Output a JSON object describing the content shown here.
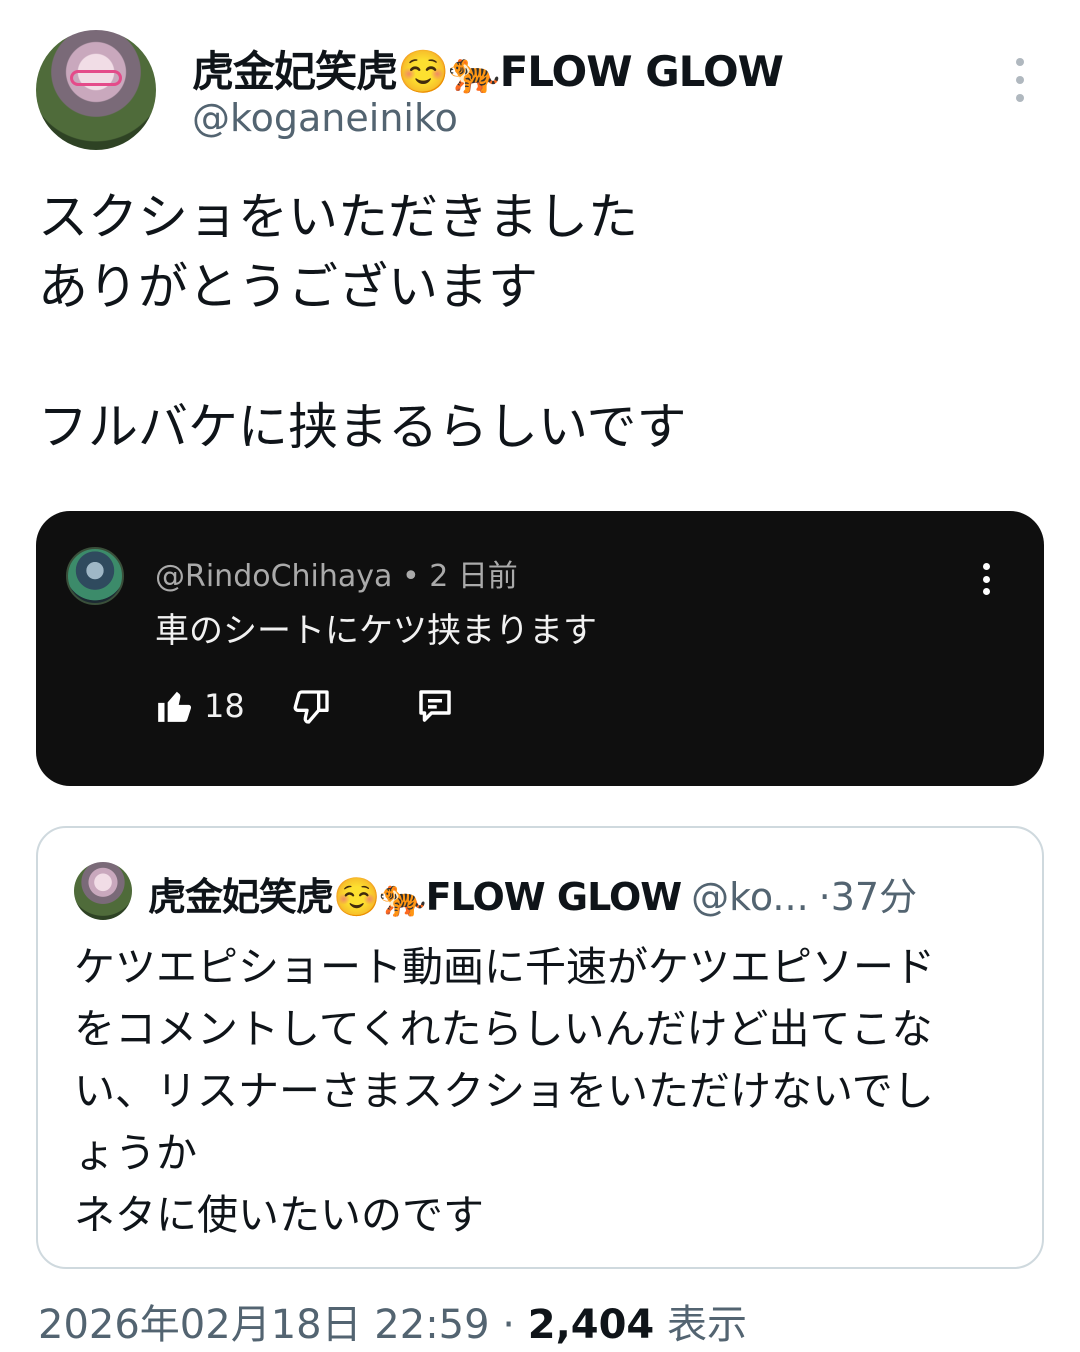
{
  "tweet": {
    "author_name": "虎金妃笑虎☺️🐅FLOW GLOW",
    "author_handle": "@koganeiniko",
    "text": "スクショをいただきました\nありがとうございます\n\nフルバケに挟まるらしいです"
  },
  "youtube_comment": {
    "meta": "@RindoChihaya • 2 日前",
    "comment": "車のシートにケツ挟まります",
    "like_count": "18",
    "icons": [
      "thumbs-up-icon",
      "thumbs-down-icon",
      "reply-icon",
      "more-vertical-icon"
    ]
  },
  "quoted_tweet": {
    "author_name": "虎金妃笑虎☺️🐅FLOW GLOW",
    "author_handle": "@ko...",
    "separator": "·",
    "time": "37分",
    "text": "ケツエピショート動画に千速がケツエピソード\nをコメントしてくれたらしいんだけど出てこな\nい、リスナーさまスクショをいただけないでし\nょうか\nネタに使いたいのです"
  },
  "footer": {
    "datetime": "2026年02月18日 22:59 · ",
    "views": "2,404",
    "views_label": " 表示"
  },
  "colors": {
    "primary_text": "#0f1419",
    "secondary_text": "#536471",
    "card_dark_bg": "#0f0f0f",
    "border": "#cfd9de"
  }
}
